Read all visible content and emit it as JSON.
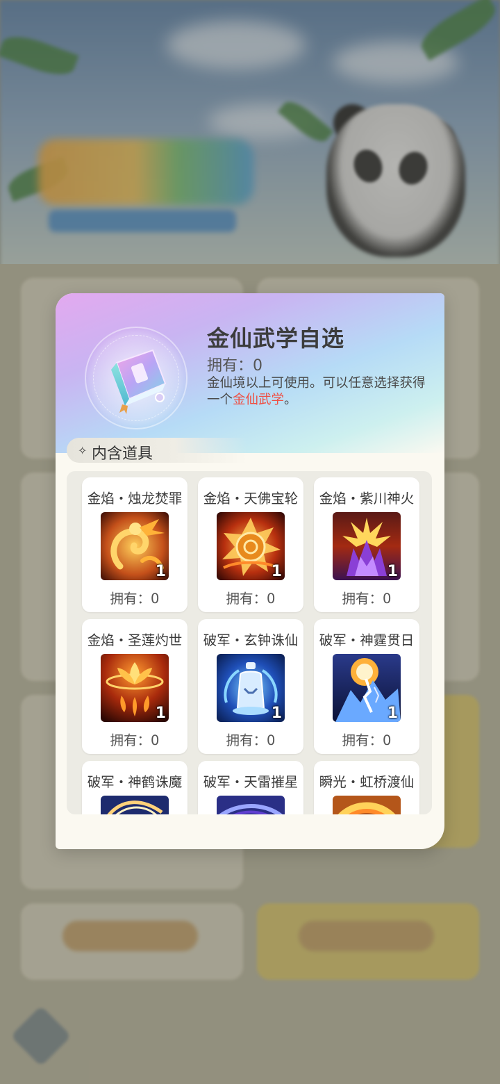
{
  "modal": {
    "title": "金仙武学自选",
    "owned_label": "拥有：0",
    "description_prefix": "金仙境以上可使用。可以任意选择获得一个",
    "description_highlight": "金仙武学",
    "description_suffix": "。",
    "highlight_color": "#ef4f43",
    "item_icon": "skill-book-icon",
    "section": {
      "icon": "diamond-icon",
      "label": "内含道具"
    },
    "items": [
      {
        "name": "金焰・烛龙焚罪",
        "qty": "1",
        "owned": "拥有：0",
        "icon": "golden-dragon-icon"
      },
      {
        "name": "金焰・天佛宝轮",
        "qty": "1",
        "owned": "拥有：0",
        "icon": "buddha-wheel-icon"
      },
      {
        "name": "金焰・紫川神火",
        "qty": "1",
        "owned": "拥有：0",
        "icon": "purple-flame-icon"
      },
      {
        "name": "金焰・圣莲灼世",
        "qty": "1",
        "owned": "拥有：0",
        "icon": "holy-lotus-icon"
      },
      {
        "name": "破军・玄钟诛仙",
        "qty": "1",
        "owned": "拥有：0",
        "icon": "mystic-bell-icon"
      },
      {
        "name": "破军・神霆贯日",
        "qty": "1",
        "owned": "拥有：0",
        "icon": "thunder-sun-icon"
      },
      {
        "name": "破军・神鹤诛魔",
        "icon": "crane-icon"
      },
      {
        "name": "破军・天雷摧星",
        "icon": "thunder-star-icon"
      },
      {
        "name": "瞬光・虹桥渡仙",
        "icon": "rainbow-bridge-icon"
      }
    ]
  }
}
